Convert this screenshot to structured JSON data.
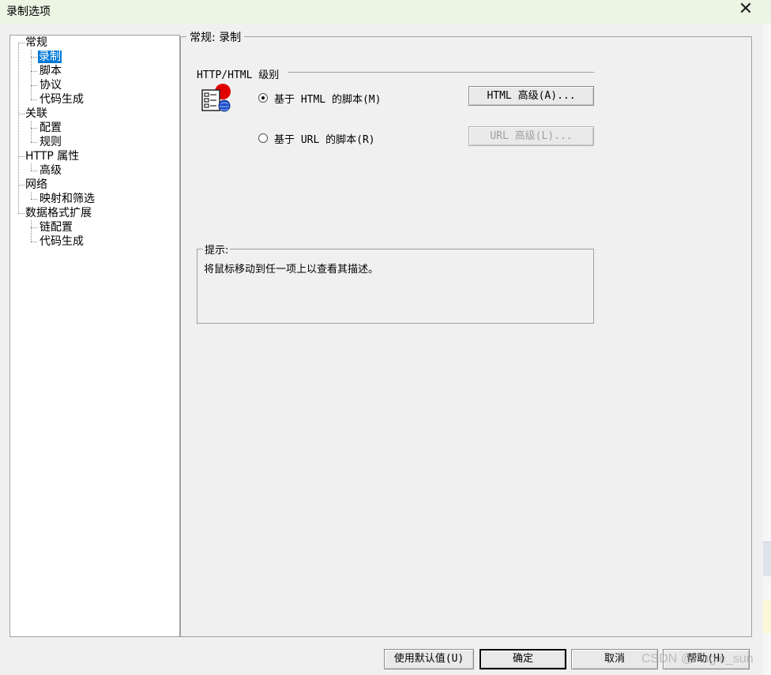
{
  "window": {
    "title": "录制选项"
  },
  "tree": {
    "items": [
      {
        "label": "常规"
      },
      {
        "label": "录制"
      },
      {
        "label": "脚本"
      },
      {
        "label": "协议"
      },
      {
        "label": "代码生成"
      },
      {
        "label": "关联"
      },
      {
        "label": "配置"
      },
      {
        "label": "规则"
      },
      {
        "label": "HTTP 属性"
      },
      {
        "label": "高级"
      },
      {
        "label": "网络"
      },
      {
        "label": "映射和筛选"
      },
      {
        "label": "数据格式扩展"
      },
      {
        "label": "链配置"
      },
      {
        "label": "代码生成"
      }
    ],
    "selected": "录制"
  },
  "panel": {
    "title": "常规: 录制",
    "group_label": "HTTP/HTML 级别",
    "icon": "recording-script-icon",
    "options": [
      {
        "label": "基于 HTML 的脚本(M)",
        "checked": true
      },
      {
        "label": "基于 URL 的脚本(R)",
        "checked": false
      }
    ],
    "buttons": {
      "html_advanced": "HTML 高级(A)...",
      "url_advanced": "URL 高级(L)..."
    },
    "hint": {
      "title": "提示:",
      "text": "将鼠标移动到任一项上以查看其描述。"
    }
  },
  "footer": {
    "use_default": "使用默认值(U)",
    "ok": "确定",
    "cancel": "取消",
    "help": "帮助(H)"
  },
  "watermark": "CSDN @Angie_sun",
  "colors": {
    "selection": "#0078d7",
    "titlebar": "#ecf5e4",
    "dialog_bg": "#f0f0f0"
  }
}
